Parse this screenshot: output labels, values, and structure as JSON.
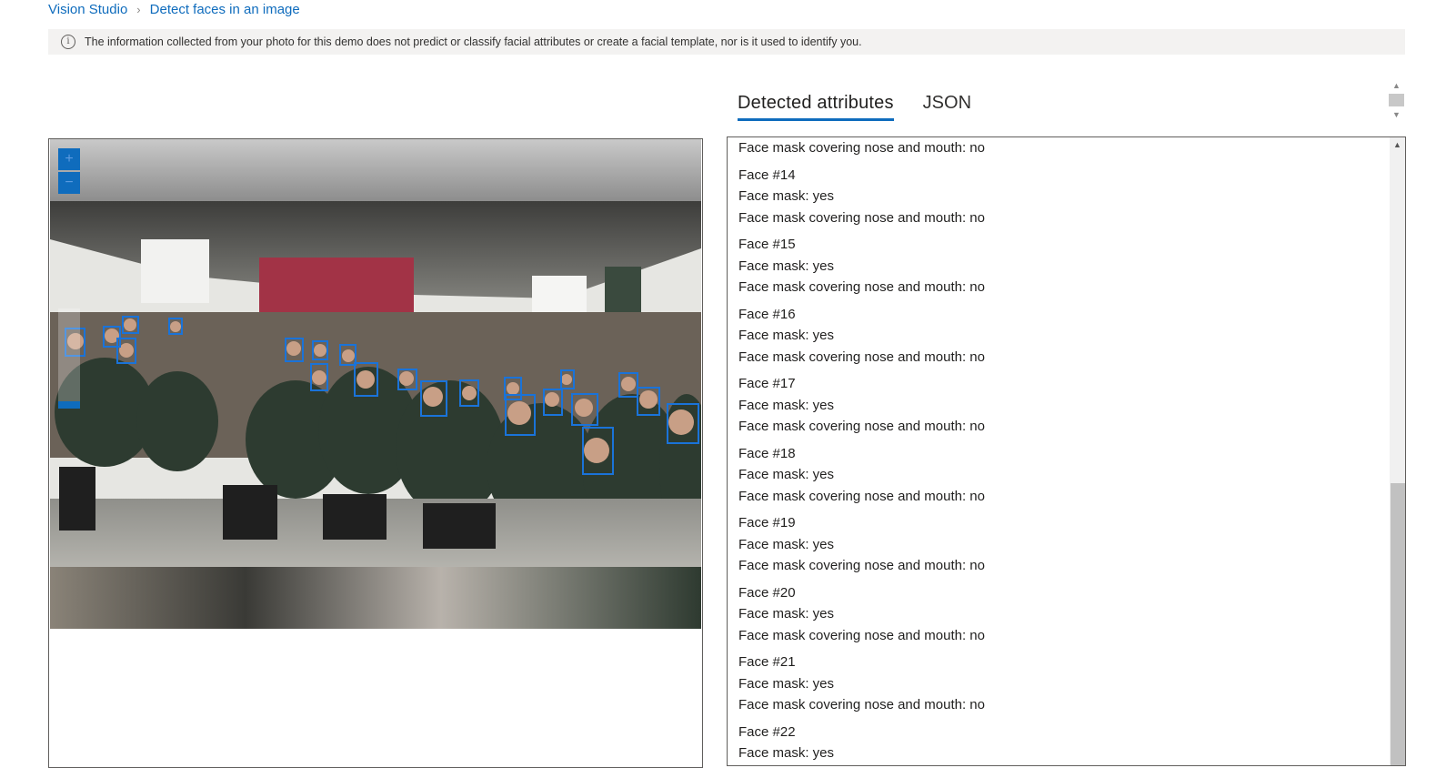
{
  "breadcrumb": {
    "home": "Vision Studio",
    "separator": "›",
    "current": "Detect faces in an image"
  },
  "notice": {
    "icon": "info-icon",
    "text": "The information collected from your photo for this demo does not predict or classify facial attributes or create a facial template, nor is it used to identify you."
  },
  "tabs": [
    {
      "label": "Detected attributes",
      "active": true
    },
    {
      "label": "JSON",
      "active": false
    }
  ],
  "zoom": {
    "in": "+",
    "out": "−"
  },
  "results": {
    "first_line": "Face mask covering nose and mouth: no",
    "faces": [
      {
        "title": "Face #14",
        "mask": "Face mask: yes",
        "covering": "Face mask covering nose and mouth: no"
      },
      {
        "title": "Face #15",
        "mask": "Face mask: yes",
        "covering": "Face mask covering nose and mouth: no"
      },
      {
        "title": "Face #16",
        "mask": "Face mask: yes",
        "covering": "Face mask covering nose and mouth: no"
      },
      {
        "title": "Face #17",
        "mask": "Face mask: yes",
        "covering": "Face mask covering nose and mouth: no"
      },
      {
        "title": "Face #18",
        "mask": "Face mask: yes",
        "covering": "Face mask covering nose and mouth: no"
      },
      {
        "title": "Face #19",
        "mask": "Face mask: yes",
        "covering": "Face mask covering nose and mouth: no"
      },
      {
        "title": "Face #20",
        "mask": "Face mask: yes",
        "covering": "Face mask covering nose and mouth: no"
      },
      {
        "title": "Face #21",
        "mask": "Face mask: yes",
        "covering": "Face mask covering nose and mouth: no"
      },
      {
        "title": "Face #22",
        "mask": "Face mask: yes",
        "covering": ""
      }
    ]
  },
  "colors": {
    "accent": "#0f6cbd",
    "face_box": "#1a73d9",
    "notice_bg": "#f3f2f1"
  }
}
